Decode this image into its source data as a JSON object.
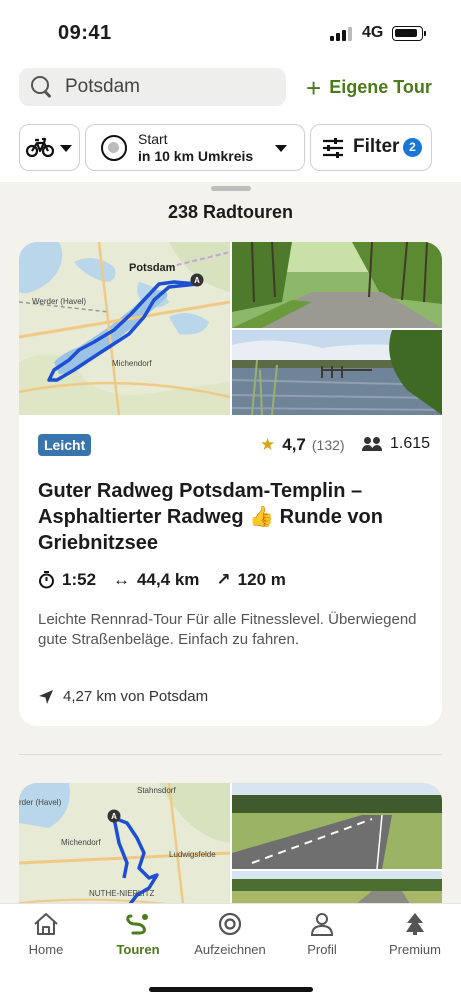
{
  "status": {
    "time": "09:41",
    "network": "4G"
  },
  "search": {
    "placeholder": "Potsdam",
    "value": "Potsdam"
  },
  "header": {
    "own_tour_label": "Eigene Tour"
  },
  "filters": {
    "sport_icon": "bicycle-icon",
    "start_line1": "Start",
    "start_line2": "in 10 km Umkreis",
    "filter_label": "Filter",
    "filter_count": "2"
  },
  "results": {
    "count_label": "238 Radtouren"
  },
  "tours": [
    {
      "difficulty": "Leicht",
      "rating": "4,7",
      "rating_count": "(132)",
      "users": "1.615",
      "title": "Guter Radweg Potsdam-Templin – Asphaltierter Radweg 👍 Runde von Griebnitzsee",
      "duration": "1:52",
      "distance": "44,4 km",
      "elevation": "120 m",
      "description": "Leichte Rennrad-Tour Für alle Fitnesslevel. Überwiegend gute Straßenbeläge. Einfach zu fahren.",
      "distance_from": "4,27 km von Potsdam",
      "map_labels": {
        "city": "Potsdam",
        "west": "Werder (Havel)",
        "south": "Michendorf",
        "marker": "A"
      }
    },
    {
      "map_labels": {
        "north": "Stahnsdorf",
        "west": "rder (Havel)",
        "mid": "Michendorf",
        "east": "Ludwigsfelde",
        "south": "NUTHE-NIEPLITZ",
        "marker": "A"
      }
    }
  ],
  "nav": {
    "items": [
      {
        "label": "Home",
        "icon": "home-icon"
      },
      {
        "label": "Touren",
        "icon": "route-icon"
      },
      {
        "label": "Aufzeichnen",
        "icon": "record-icon"
      },
      {
        "label": "Profil",
        "icon": "profile-icon"
      },
      {
        "label": "Premium",
        "icon": "premium-icon"
      }
    ],
    "active": "Touren"
  },
  "colors": {
    "accent": "#4a7a1a",
    "badge_blue": "#1877d6",
    "difficulty_blue": "#3a74ad",
    "route_blue": "#1c4fd6",
    "background": "#f3f2ec"
  }
}
